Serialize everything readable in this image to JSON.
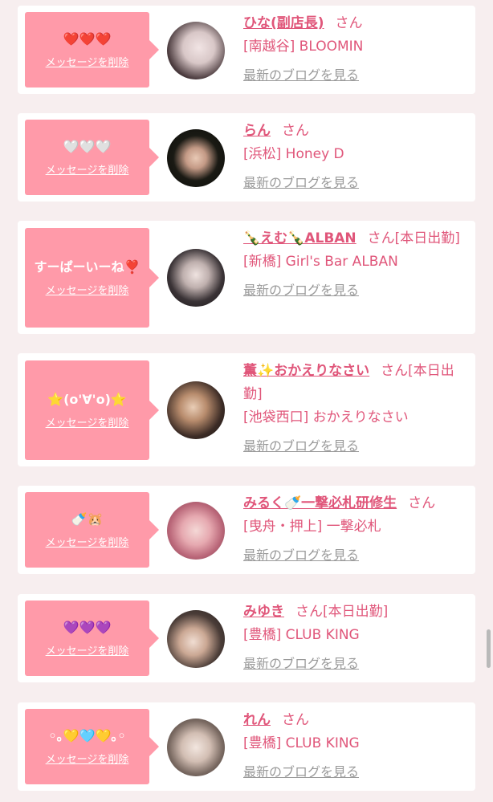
{
  "delete_label": "メッセージを削除",
  "san_label": "さん",
  "blog_label": "最新のブログを見る",
  "accent_color": "#ff9aa9",
  "name_color": "#e0567a",
  "entries": [
    {
      "message": "❤️❤️❤️",
      "name": "ひな(副店長)",
      "status": "",
      "shop": "[南越谷] BLOOMIN"
    },
    {
      "message": "🤍🤍🤍",
      "name": "らん",
      "status": "",
      "shop": "[浜松] Honey D"
    },
    {
      "message": "すーぱーいーね❣️",
      "name": "🍾えむ🍾ALBAN",
      "status": "[本日出勤]",
      "shop": "[新橋] Girl's Bar ALBAN"
    },
    {
      "message": "⭐️(o'∀'o)⭐️",
      "name": "薫✨おかえりなさい",
      "status": "[本日出勤]",
      "shop": "[池袋西口] おかえりなさい"
    },
    {
      "message": "🍼🐹",
      "name": "みるく🍼一撃必札研修生",
      "status": "",
      "shop": "[曳舟・押上] 一撃必札"
    },
    {
      "message": "💜💜💜",
      "name": "みゆき",
      "status": "[本日出勤]",
      "shop": "[豊橋] CLUB KING"
    },
    {
      "message": "◦｡💛🩵💛｡◦",
      "name": "れん",
      "status": "",
      "shop": "[豊橋] CLUB KING"
    }
  ]
}
